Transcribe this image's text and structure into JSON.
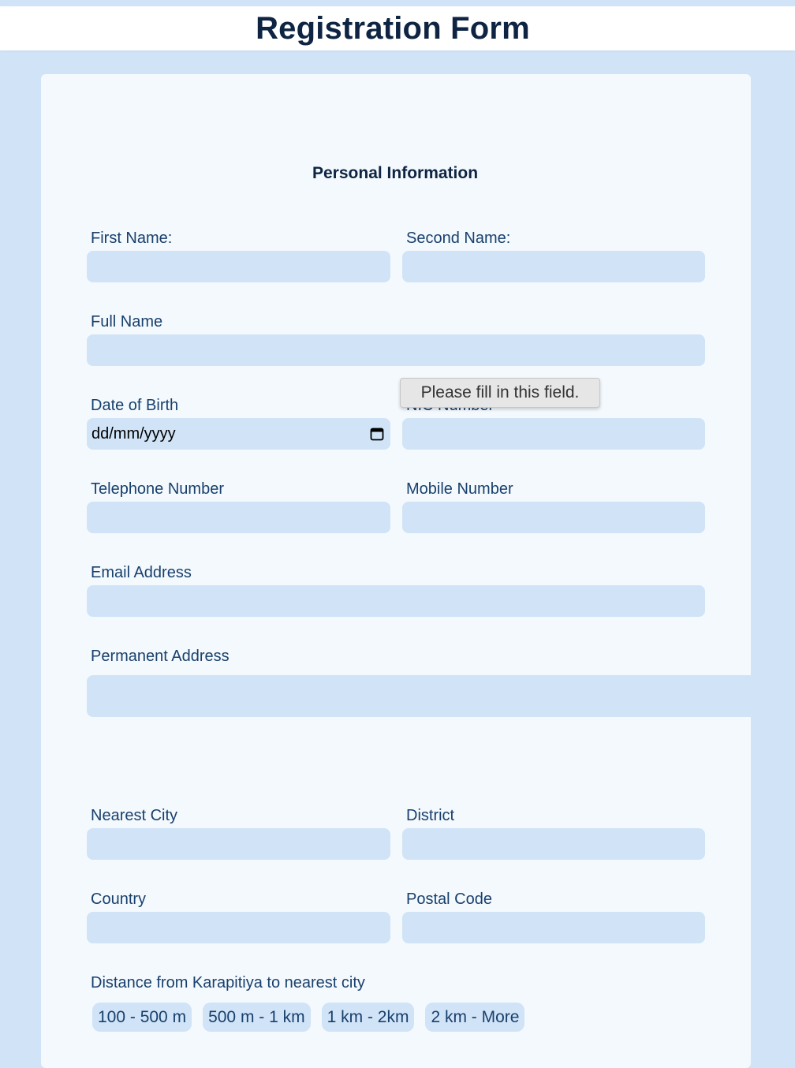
{
  "header": {
    "title": "Registration Form"
  },
  "section": {
    "title": "Personal Information"
  },
  "fields": {
    "first_name": {
      "label": "First Name:",
      "value": ""
    },
    "second_name": {
      "label": "Second Name:",
      "value": ""
    },
    "full_name": {
      "label": "Full Name",
      "value": ""
    },
    "date_of_birth": {
      "label": "Date of Birth",
      "placeholder": "dd/mm/yyyy"
    },
    "nic_number": {
      "label": "NIC Number",
      "value": ""
    },
    "telephone_number": {
      "label": "Telephone Number",
      "value": ""
    },
    "mobile_number": {
      "label": "Mobile Number",
      "value": ""
    },
    "email_address": {
      "label": "Email Address",
      "value": ""
    },
    "permanent_address": {
      "label": "Permanent Address",
      "value": ""
    },
    "nearest_city": {
      "label": "Nearest City",
      "value": ""
    },
    "district": {
      "label": "District",
      "value": ""
    },
    "country": {
      "label": "Country",
      "value": ""
    },
    "postal_code": {
      "label": "Postal Code",
      "value": ""
    }
  },
  "tooltip": {
    "text": "Please fill in this field."
  },
  "distance": {
    "label": "Distance from Karapitiya to nearest city",
    "options": [
      "100 - 500 m",
      "500 m - 1 km",
      "1 km - 2km",
      "2 km - More"
    ]
  },
  "icons": {
    "calendar": "calendar-icon"
  }
}
